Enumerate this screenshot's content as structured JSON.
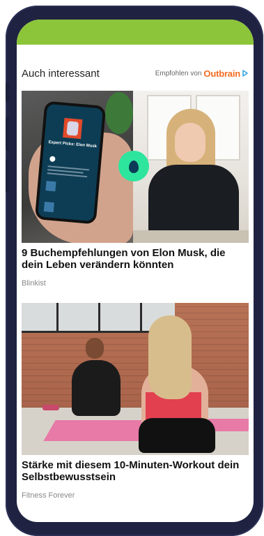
{
  "section": {
    "title": "Auch interessant",
    "recommended_prefix": "Empfohlen von",
    "recommended_brand": "Outbrain"
  },
  "cards": [
    {
      "title": "9 Buchempfehlungen von Elon Musk, die dein Leben verändern könnten",
      "source": "Blinkist",
      "phone_screen_title": "Expert Picks: Elon Musk"
    },
    {
      "title": "Stärke mit diesem 10-Minuten-Workout dein Selbstbewusstsein",
      "source": "Fitness Forever"
    }
  ],
  "colors": {
    "header_bar": "#8cc43a",
    "outbrain_orange": "#f26b21",
    "phone_frame": "#1f2240",
    "blinkist_green": "#2ee59d"
  }
}
